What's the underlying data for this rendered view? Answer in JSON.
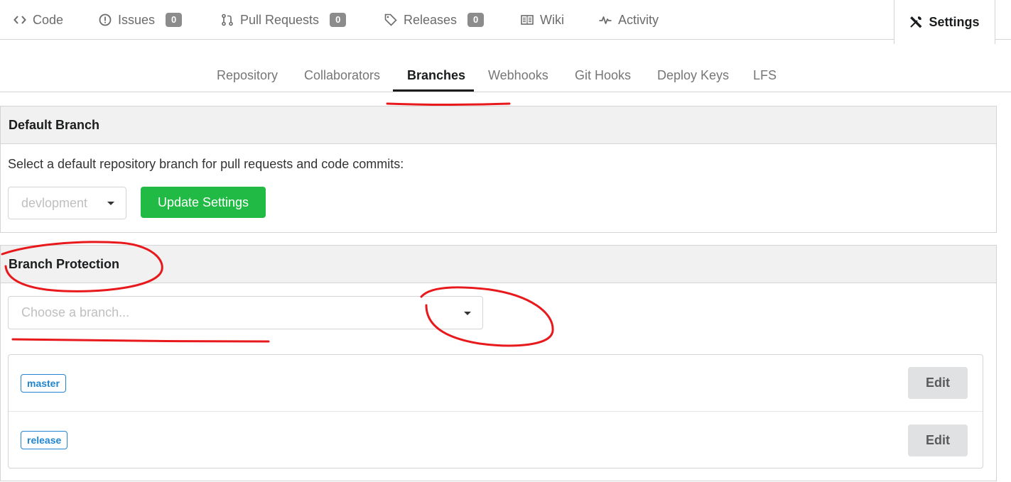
{
  "repo_tabs": {
    "code": {
      "label": "Code",
      "icon": "code-icon"
    },
    "issues": {
      "label": "Issues",
      "count": "0",
      "icon": "issue-icon"
    },
    "pull_requests": {
      "label": "Pull Requests",
      "count": "0",
      "icon": "pull-request-icon"
    },
    "releases": {
      "label": "Releases",
      "count": "0",
      "icon": "tag-icon"
    },
    "wiki": {
      "label": "Wiki",
      "icon": "book-icon"
    },
    "activity": {
      "label": "Activity",
      "icon": "pulse-icon"
    },
    "settings": {
      "label": "Settings",
      "icon": "tools-icon",
      "active": true
    }
  },
  "settings_menu": {
    "items": [
      "Repository",
      "Collaborators",
      "Branches",
      "Webhooks",
      "Git Hooks",
      "Deploy Keys",
      "LFS"
    ],
    "active": "Branches"
  },
  "default_branch": {
    "header": "Default Branch",
    "description": "Select a default repository branch for pull requests and code commits:",
    "selected": "devlopment",
    "update_button": "Update Settings"
  },
  "branch_protection": {
    "header": "Branch Protection",
    "placeholder": "Choose a branch...",
    "branches": [
      {
        "name": "master",
        "action": "Edit"
      },
      {
        "name": "release",
        "action": "Edit"
      }
    ]
  },
  "colors": {
    "accent_green": "#21ba45",
    "label_blue": "#2185d0",
    "annotation_red": "#e8191c"
  }
}
